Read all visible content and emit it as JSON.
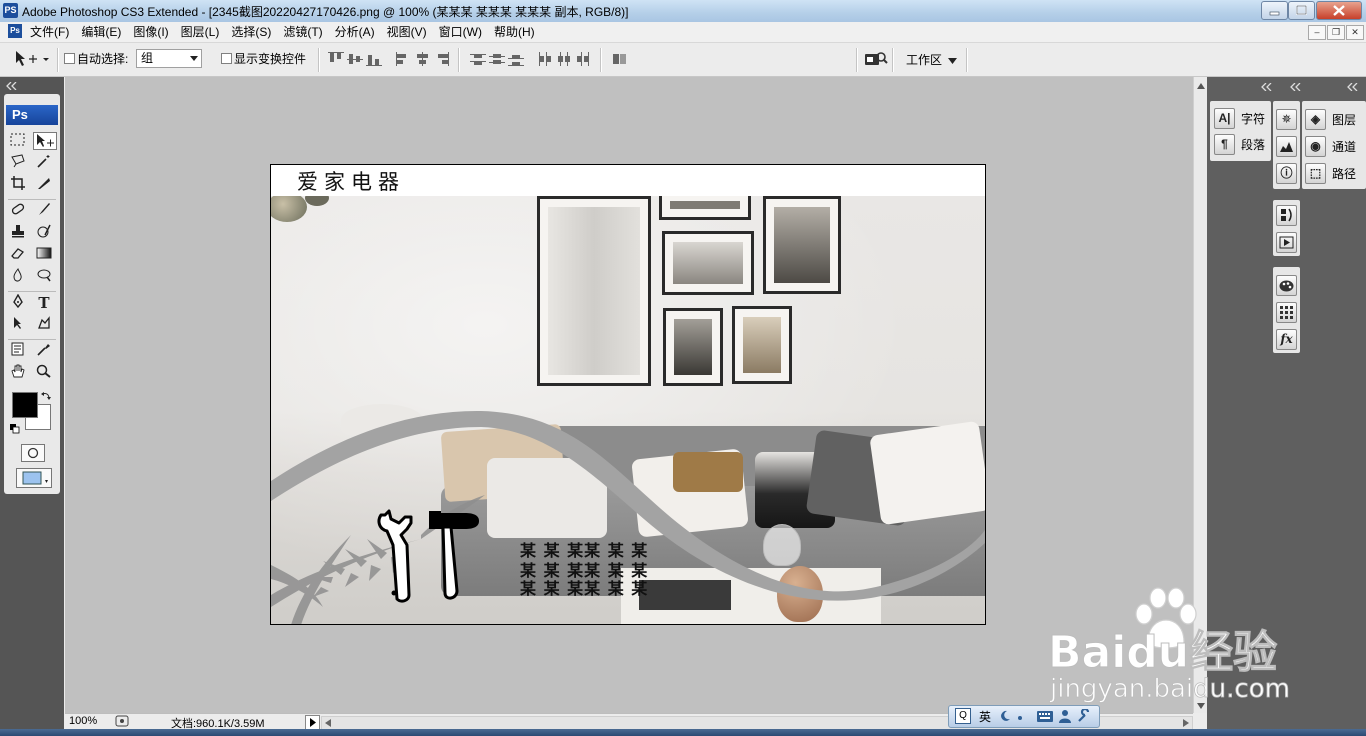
{
  "window": {
    "app_icon": "PS",
    "title": "Adobe Photoshop CS3 Extended - [2345截图20220427170426.png @ 100% (某某某 某某某 某某某 副本, RGB/8)]"
  },
  "menu": {
    "icon": "Ps",
    "items": [
      "文件(F)",
      "编辑(E)",
      "图像(I)",
      "图层(L)",
      "选择(S)",
      "滤镜(T)",
      "分析(A)",
      "视图(V)",
      "窗口(W)",
      "帮助(H)"
    ]
  },
  "options": {
    "auto_select_label": "自动选择:",
    "auto_select_checked": false,
    "group_value": "组",
    "show_transform_label": "显示变换控件",
    "show_transform_checked": false,
    "workspace_label": "工作区"
  },
  "toolbox": {
    "header": "Ps",
    "foreground_color": "#000000",
    "background_color": "#ffffff"
  },
  "document": {
    "title_text": "爱家电器",
    "placeholder_lines": [
      "某 某 某某 某 某",
      "某 某 某某 某 某",
      "某 某 某某 某 某"
    ],
    "wave_color": "#a3a3a3"
  },
  "status": {
    "zoom": "100%",
    "doc_size": "文档:960.1K/3.59M"
  },
  "panels": {
    "group1": [
      {
        "icon": "character-icon",
        "glyph": "A|",
        "label": "字符"
      },
      {
        "icon": "paragraph-icon",
        "glyph": "¶",
        "label": "段落"
      }
    ],
    "group3": [
      {
        "icon": "layers-icon",
        "glyph": "◈",
        "label": "图层"
      },
      {
        "icon": "channels-icon",
        "glyph": "◉",
        "label": "通道"
      },
      {
        "icon": "paths-icon",
        "glyph": "⬚",
        "label": "路径"
      }
    ]
  },
  "ime": {
    "mode": "英"
  },
  "watermark": {
    "brand": "Baidu经验",
    "url": "jingyan.baidu.com"
  }
}
